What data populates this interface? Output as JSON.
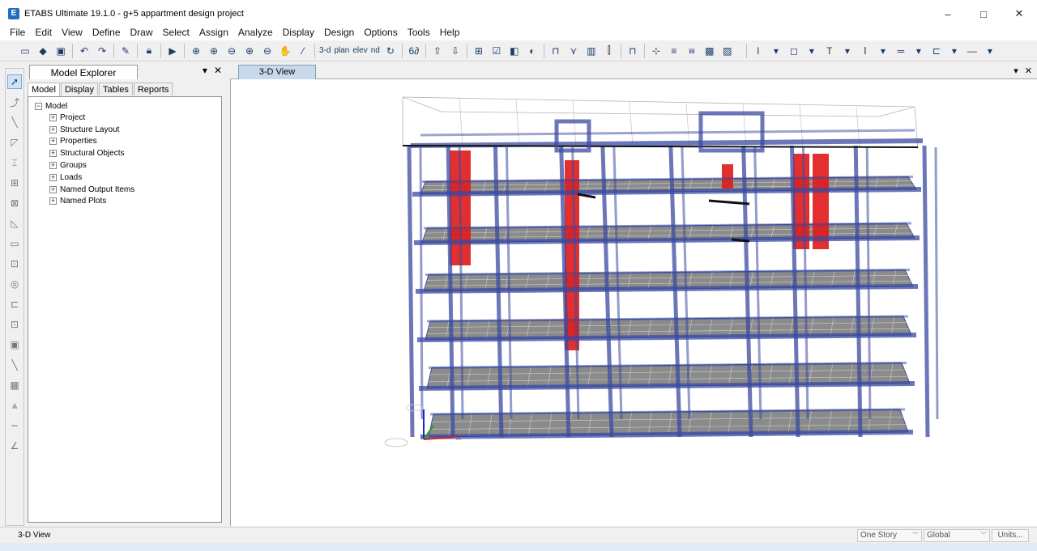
{
  "window": {
    "title": "ETABS Ultimate 19.1.0 - g+5 appartment design project",
    "app_icon_letter": "E",
    "controls": [
      "–",
      "□",
      "✕"
    ]
  },
  "menu": [
    "File",
    "Edit",
    "View",
    "Define",
    "Draw",
    "Select",
    "Assign",
    "Analyze",
    "Display",
    "Design",
    "Options",
    "Tools",
    "Help"
  ],
  "toolbar": {
    "text_buttons": [
      "3-d",
      "plan",
      "elev",
      "nd"
    ]
  },
  "explorer": {
    "title": "Model Explorer",
    "controls": [
      "▾",
      "✕"
    ],
    "subtabs": [
      "Model",
      "Display",
      "Tables",
      "Reports"
    ],
    "tree_root": "Model",
    "tree_items": [
      "Project",
      "Structure Layout",
      "Properties",
      "Structural Objects",
      "Groups",
      "Loads",
      "Named Output Items",
      "Named Plots"
    ]
  },
  "view": {
    "tab_label": "3-D View",
    "controls": [
      "▾",
      "✕"
    ],
    "axis_x_label": "X"
  },
  "status": {
    "left_text": "3-D View",
    "story_select": "One Story",
    "coord_select": "Global",
    "units_button": "Units..."
  },
  "colors": {
    "frame": "#3a4aa0",
    "shear_wall": "#e01818",
    "slab": "#2b2b2b"
  }
}
